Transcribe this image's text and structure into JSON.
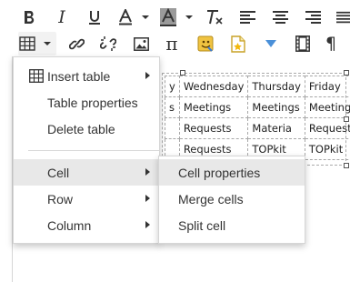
{
  "toolbar": {
    "italic_glyph": "I",
    "pi_glyph": "π",
    "paragraph_glyph": "¶"
  },
  "table": {
    "rows": [
      [
        "y",
        "Wednesday",
        "Thursday",
        "Friday"
      ],
      [
        "s",
        "Meetings",
        "Meetings",
        "Meetings"
      ],
      [
        "",
        "Requests",
        "Materia",
        "Requests"
      ],
      [
        "",
        "Requests",
        "TOPkit",
        "TOPkit"
      ]
    ]
  },
  "context_menu": {
    "insert_table": "Insert table",
    "table_properties": "Table properties",
    "delete_table": "Delete table",
    "cell": "Cell",
    "row": "Row",
    "column": "Column"
  },
  "cell_submenu": {
    "cell_properties": "Cell properties",
    "merge_cells": "Merge cells",
    "split_cell": "Split cell"
  }
}
